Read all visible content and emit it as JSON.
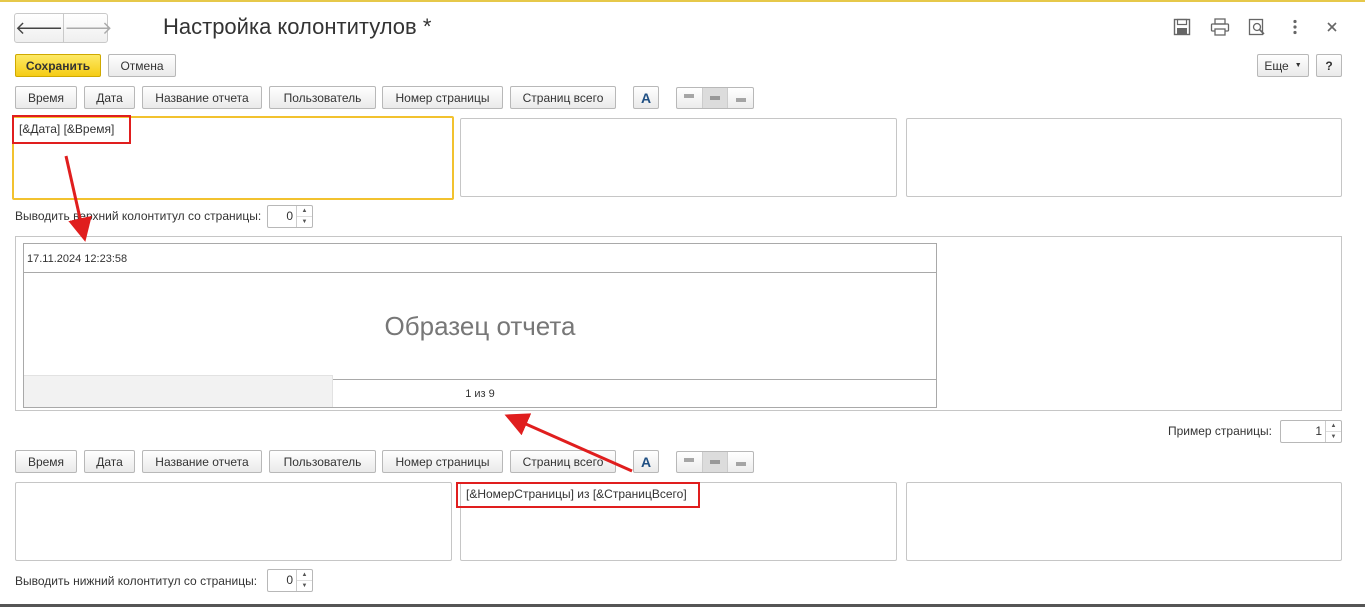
{
  "window": {
    "title": "Настройка колонтитулов *",
    "icons": [
      "save-icon",
      "print-icon",
      "preview-icon",
      "more-vertical-icon",
      "close-icon"
    ]
  },
  "nav": {
    "back": "🡐",
    "forward": "🡒"
  },
  "toolbar": {
    "save_label": "Сохранить",
    "cancel_label": "Отмена",
    "more_label": "Еще",
    "help_label": "?"
  },
  "header_section": {
    "buttons": [
      "Время",
      "Дата",
      "Название отчета",
      "Пользователь",
      "Номер страницы",
      "Страниц всего"
    ],
    "font_button": "A",
    "left_text": "[&Дата]  [&Время]",
    "center_text": "",
    "right_text": "",
    "start_page_label": "Выводить верхний колонтитул со страницы:",
    "start_page_value": "0"
  },
  "preview": {
    "header_text": "17.11.2024  12:23:58",
    "sample_text": "Образец отчета",
    "footer_text": "1 из 9"
  },
  "page_example": {
    "label": "Пример страницы:",
    "value": "1"
  },
  "footer_section": {
    "buttons": [
      "Время",
      "Дата",
      "Название отчета",
      "Пользователь",
      "Номер страницы",
      "Страниц всего"
    ],
    "font_button": "A",
    "left_text": "",
    "center_text": "[&НомерСтраницы] из [&СтраницВсего]",
    "right_text": "",
    "start_page_label": "Выводить нижний колонтитул со страницы:",
    "start_page_value": "0"
  },
  "colors": {
    "accent_yellow": "#f5cc15",
    "focus_border": "#f2c22f",
    "annotation_red": "#e01e1e"
  }
}
